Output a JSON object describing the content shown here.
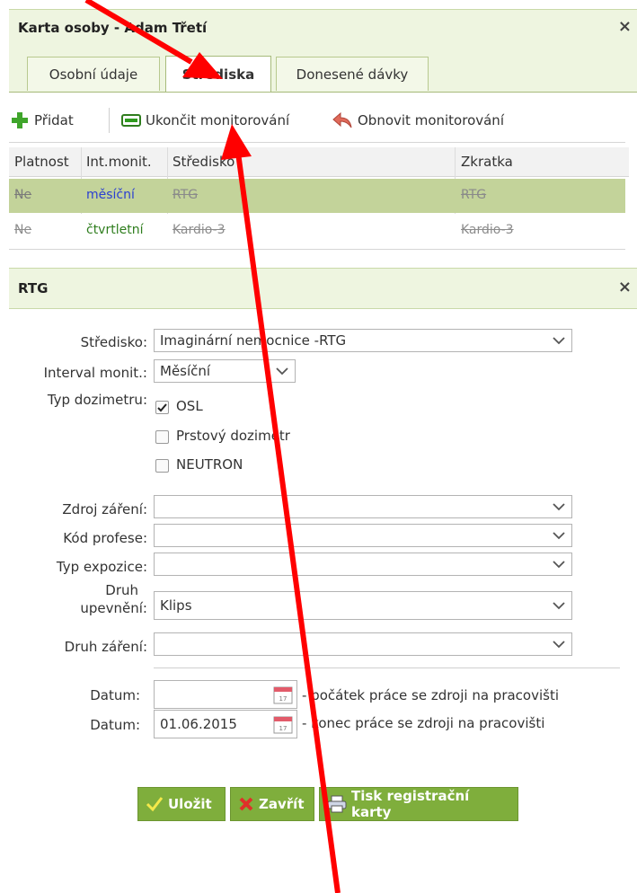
{
  "window": {
    "title": "Karta osoby - Adam Třetí"
  },
  "tabs": [
    {
      "label": "Osobní údaje"
    },
    {
      "label": "Střediska"
    },
    {
      "label": "Donesené dávky"
    }
  ],
  "toolbar": {
    "add_label": "Přidat",
    "stop_label": "Ukončit monitorování",
    "restore_label": "Obnovit monitorování"
  },
  "grid": {
    "columns": [
      "Platnost",
      "Int.monit.",
      "Středisko",
      "Zkratka"
    ],
    "rows": [
      {
        "platnost": "Ne",
        "interval": "měsíční",
        "stredisko": "RTG",
        "zkratka": "RTG"
      },
      {
        "platnost": "Ne",
        "interval": "čtvrtletní",
        "stredisko": "Kardio-3",
        "zkratka": "Kardio-3"
      }
    ]
  },
  "detail": {
    "title": "RTG",
    "stredisko_label": "Středisko:",
    "stredisko_value": "Imaginární nemocnice -RTG",
    "interval_label": "Interval monit.:",
    "interval_value": "Měsíční",
    "dozimetr_label": "Typ dozimetru:",
    "dozimetry": [
      {
        "label": "OSL",
        "checked": true
      },
      {
        "label": "Prstový dozimetr",
        "checked": false
      },
      {
        "label": "NEUTRON",
        "checked": false
      }
    ],
    "zdroj_label": "Zdroj záření:",
    "zdroj_value": "",
    "profese_label": "Kód profese:",
    "profese_value": "",
    "expozice_label": "Typ expozice:",
    "expozice_value": "",
    "upevneni_label_1": "Druh",
    "upevneni_label_2": "upevnění:",
    "upevneni_value": "Klips",
    "zareni_label": "Druh záření:",
    "zareni_value": "",
    "datum_label": "Datum:",
    "datum1_value": "",
    "datum1_hint": "- počátek práce se zdroji na pracovišti",
    "datum2_value": "01.06.2015",
    "datum2_hint": "- konec práce se zdroji na pracovišti"
  },
  "buttons": {
    "save": "Uložit",
    "close": "Zavřít",
    "print": "Tisk registrační karty"
  },
  "colors": {
    "accent_green": "#7fae3c",
    "selected_row": "#c3d39a",
    "annotation_arrow": "#ff0000",
    "interval_monthly": "#2a3fd1",
    "interval_quarterly": "#2e7d1d"
  }
}
